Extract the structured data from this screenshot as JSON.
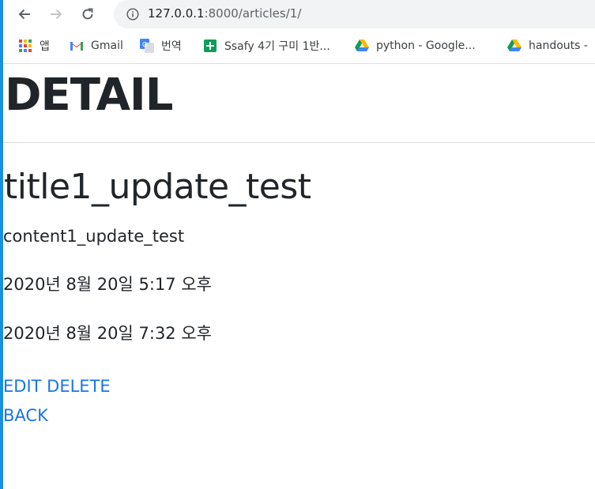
{
  "browser": {
    "url_host": "127.0.0.1",
    "url_rest": ":8000/articles/1/",
    "bookmarks": [
      {
        "label": "앱",
        "icon": "apps-grid-icon"
      },
      {
        "label": "Gmail",
        "icon": "gmail-icon"
      },
      {
        "label": "번역",
        "icon": "translate-icon"
      },
      {
        "label": "Ssafy 4기 구미 1반...",
        "icon": "sheets-icon"
      },
      {
        "label": "python - Google...",
        "icon": "google-drive-icon"
      },
      {
        "label": "handouts - ",
        "icon": "google-drive-icon"
      }
    ]
  },
  "page": {
    "heading": "DETAIL",
    "title": "title1_update_test",
    "content": "content1_update_test",
    "created_at": "2020년 8월 20일 5:17 오후",
    "updated_at": "2020년 8월 20일 7:32 오후",
    "edit_label": "EDIT",
    "delete_label": "DELETE",
    "back_label": "BACK"
  },
  "colors": {
    "link": "#1a75e8",
    "text": "#212529",
    "window_edge": "#1a8fe0"
  }
}
